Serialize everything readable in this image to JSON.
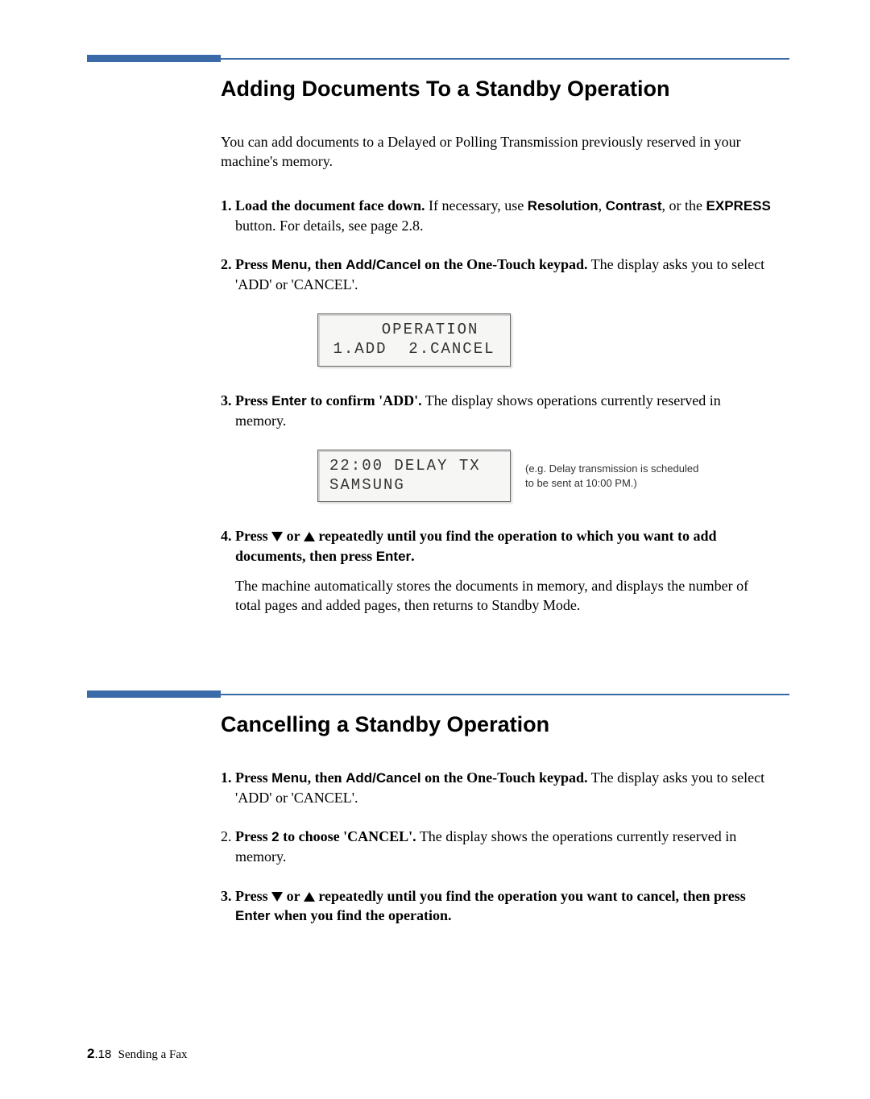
{
  "section1": {
    "title": "Adding Documents To a Standby Operation",
    "intro": "You can add documents to a Delayed or Polling Transmission previously reserved in your machine's memory.",
    "step1_a": "1. Load the document face down.",
    "step1_b": " If necessary, use ",
    "step1_res": "Resolution",
    "step1_c": ", ",
    "step1_con": "Contrast",
    "step1_d": ", or the ",
    "step1_exp": "EXPRESS",
    "step1_e": " button. For details, see page 2.8.",
    "step2_a": "2. Press ",
    "step2_menu": "Menu",
    "step2_b": ", then ",
    "step2_ac": "Add/Cancel",
    "step2_c": " on the One-Touch keypad.",
    "step2_d": " The display asks you to select 'ADD' or 'CANCEL'.",
    "lcd1": "   OPERATION\n1.ADD  2.CANCEL",
    "step3_a": "3. Press ",
    "step3_enter": "Enter",
    "step3_b": " to confirm 'ADD'.",
    "step3_c": " The display shows operations currently reserved in memory.",
    "lcd2": "22:00 DELAY TX\nSAMSUNG",
    "lcd2_note": "(e.g. Delay transmission is scheduled to be sent at 10:00 PM.)",
    "step4_a": "4. Press ",
    "step4_b": " or ",
    "step4_c": " repeatedly until you find the operation to which you want to add documents, then press ",
    "step4_enter": "Enter",
    "step4_d": ".",
    "step4_body": "The machine automatically stores the documents in memory, and displays the number of total pages and added pages, then returns to Standby Mode."
  },
  "section2": {
    "title": "Cancelling a Standby Operation",
    "step1_a": "1. Press ",
    "step1_menu": "Menu",
    "step1_b": ", then ",
    "step1_ac": "Add/Cancel",
    "step1_c": " on the One-Touch keypad.",
    "step1_d": " The display asks you to select 'ADD' or 'CANCEL'.",
    "step2_a": "2. ",
    "step2_b": "Press ",
    "step2_two": "2",
    "step2_c": " to choose 'CANCEL'.",
    "step2_d": " The display shows the operations currently reserved in memory.",
    "step3_a": "3. Press ",
    "step3_b": " or ",
    "step3_c": " repeatedly until you find the operation you want to cancel, then press ",
    "step3_enter": "Enter",
    "step3_d": " when you find the operation."
  },
  "footer": {
    "chapter": "2",
    "page": ".18",
    "label": "Sending a Fax"
  }
}
